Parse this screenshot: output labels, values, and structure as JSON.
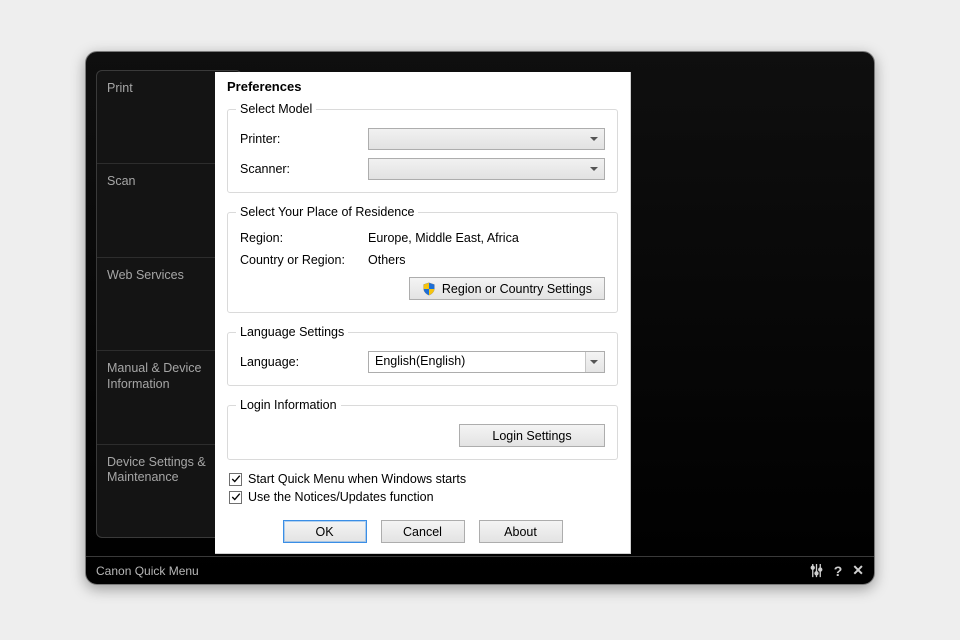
{
  "statusbar": {
    "title": "Canon Quick Menu"
  },
  "sidebar": {
    "items": [
      {
        "label": "Print"
      },
      {
        "label": "Scan"
      },
      {
        "label": "Web Services"
      },
      {
        "label": "Manual & Device Information"
      },
      {
        "label": "Device Settings & Maintenance"
      }
    ]
  },
  "dialog": {
    "title": "Preferences",
    "model": {
      "legend": "Select Model",
      "printer_label": "Printer:",
      "scanner_label": "Scanner:",
      "printer_value": "",
      "scanner_value": ""
    },
    "residence": {
      "legend": "Select Your Place of Residence",
      "region_label": "Region:",
      "region_value": "Europe, Middle East, Africa",
      "country_label": "Country or Region:",
      "country_value": "Others",
      "button": "Region or Country Settings"
    },
    "language": {
      "legend": "Language Settings",
      "label": "Language:",
      "value": "English(English)"
    },
    "login": {
      "legend": "Login Information",
      "button": "Login Settings"
    },
    "checks": {
      "start_label": "Start Quick Menu when Windows starts",
      "notices_label": "Use the Notices/Updates function"
    },
    "buttons": {
      "ok": "OK",
      "cancel": "Cancel",
      "about": "About"
    }
  }
}
